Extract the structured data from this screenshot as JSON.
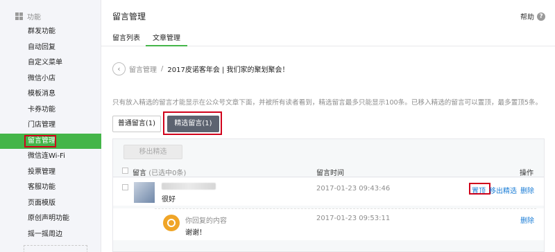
{
  "sidebar": {
    "heading": "功能",
    "items": [
      {
        "label": "群发功能"
      },
      {
        "label": "自动回复"
      },
      {
        "label": "自定义菜单"
      },
      {
        "label": "微信小店"
      },
      {
        "label": "模板消息"
      },
      {
        "label": "卡券功能"
      },
      {
        "label": "门店管理"
      },
      {
        "label": "留言管理",
        "active": true
      },
      {
        "label": "微信连Wi-Fi"
      },
      {
        "label": "投票管理"
      },
      {
        "label": "客服功能"
      },
      {
        "label": "页面模版"
      },
      {
        "label": "原创声明功能"
      },
      {
        "label": "摇一摇周边"
      }
    ]
  },
  "header": {
    "title": "留言管理",
    "help_label": "帮助",
    "help_icon": "?"
  },
  "tabs": [
    {
      "label": "留言列表"
    },
    {
      "label": "文章管理",
      "active": true
    }
  ],
  "breadcrumb": {
    "back_icon": "‹",
    "parent": "留言管理",
    "separator": "/",
    "current": "2017皮诺客年会 | 我们家的聚划聚会！"
  },
  "notice": "只有放入精选的留言才能显示在公众号文章下面，并被所有读者看到，精选留言最多只能显示100条。已移入精选的留言可以置顶，最多置顶5条。",
  "filter": {
    "normal": "普通留言(1)",
    "featured": "精选留言(1)"
  },
  "toolbar": {
    "remove_label": "移出精选"
  },
  "table": {
    "col_message": "留言",
    "col_selected": "(已选中0条)",
    "col_time": "留言时间",
    "col_ops": "操作"
  },
  "comments": [
    {
      "text": "很好",
      "time": "2017-01-23 09:43:46",
      "ops": {
        "pin": "置顶",
        "unfeature": "移出精选",
        "delete": "删除"
      },
      "reply": {
        "label": "你回复的内容",
        "text": "谢谢！",
        "time": "2017-01-23 09:53:11",
        "delete": "删除"
      }
    }
  ],
  "colors": {
    "accent": "#44b549",
    "highlight": "#d0021b",
    "link": "#1b7dd6"
  }
}
